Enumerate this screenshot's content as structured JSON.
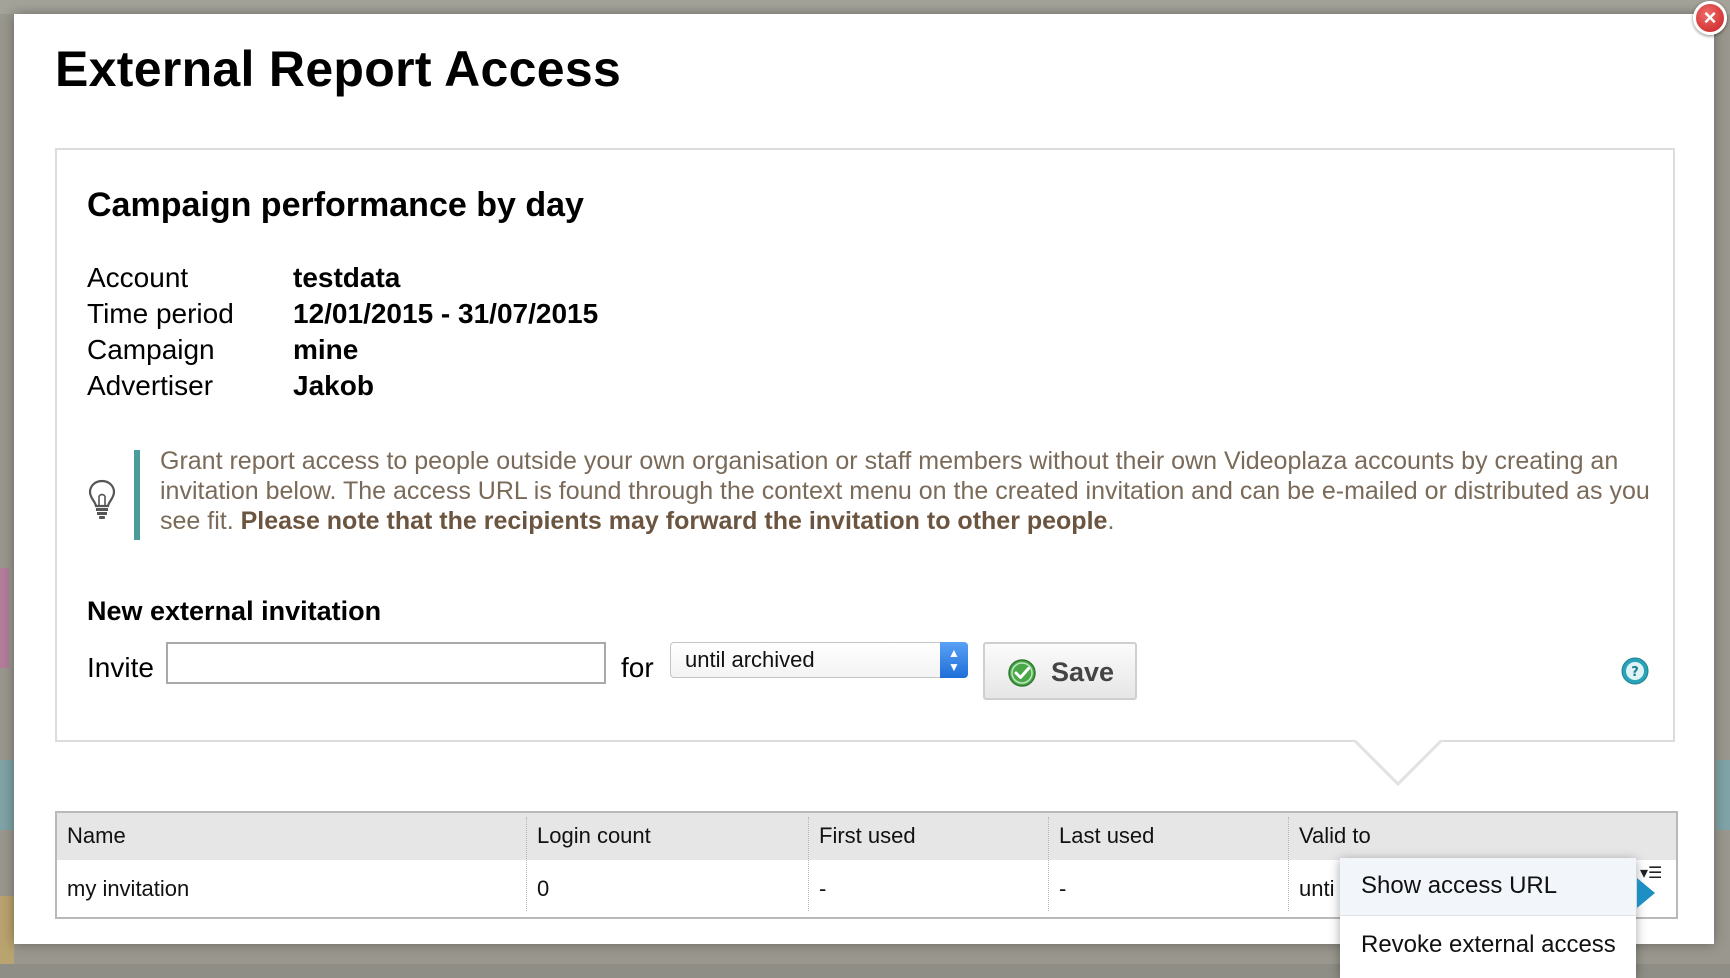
{
  "dialog": {
    "title": "External Report Access",
    "close_icon": "close-icon"
  },
  "report": {
    "title": "Campaign performance by day",
    "meta": [
      {
        "label": "Account",
        "value": "testdata"
      },
      {
        "label": "Time period",
        "value": "12/01/2015 - 31/07/2015"
      },
      {
        "label": "Campaign",
        "value": "mine"
      },
      {
        "label": "Advertiser",
        "value": "Jakob"
      }
    ]
  },
  "info": {
    "icon": "lightbulb-icon",
    "text": "Grant report access to people outside your own organisation or staff members without their own Videoplaza accounts by creating an invitation below. The access URL is found through the context menu on the created invitation and can be e-mailed or distributed as you see fit.",
    "emphasis": "Please note that the recipients may forward the invitation to other people",
    "suffix": "."
  },
  "new_invitation": {
    "title": "New external invitation",
    "invite_label": "Invite",
    "invite_value": "",
    "for_label": "for",
    "duration_selected": "until archived",
    "save_label": "Save",
    "save_icon": "check-circle-icon",
    "help_icon": "help-icon"
  },
  "table": {
    "columns": [
      "Name",
      "Login count",
      "First used",
      "Last used",
      "Valid to"
    ],
    "rows": [
      {
        "name": "my invitation",
        "login_count": "0",
        "first_used": "-",
        "last_used": "-",
        "valid_to": "unti"
      }
    ],
    "row_menu_icon": "menu-dropdown-icon"
  },
  "context_menu": {
    "items": [
      "Show access URL",
      "Revoke external access"
    ]
  },
  "colors": {
    "info_bar": "#4a9c9a",
    "info_text": "#7a6a59",
    "close": "#c82020",
    "select_arrow": "#1e6ed9",
    "context_pointer": "#1d8fc5"
  }
}
